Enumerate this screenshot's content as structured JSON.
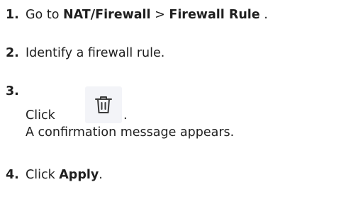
{
  "steps": [
    {
      "number": "1.",
      "prefix": "Go to ",
      "menu": "NAT/Firewall",
      "separator": " > ",
      "submenu": "Firewall Rule",
      "suffix": " ."
    },
    {
      "number": "2.",
      "text": "Identify a firewall rule."
    },
    {
      "number": "3.",
      "click_label": "Click",
      "period": ".",
      "icon": "trash-icon",
      "result": "A confirmation message appears."
    },
    {
      "number": "4.",
      "prefix": "Click ",
      "button": "Apply",
      "suffix": "."
    }
  ]
}
